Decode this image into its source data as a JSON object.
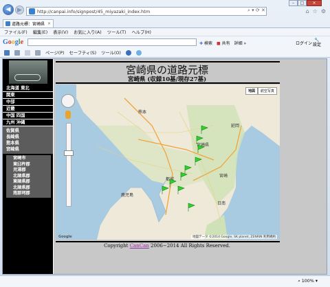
{
  "browser": {
    "url": "http://canpai.info/signpost/45_miyazaki_index.htm",
    "tab_title": "道路元標：宮崎県",
    "window_controls": [
      "–",
      "□",
      "×"
    ],
    "menu": [
      "ファイル(F)",
      "編集(E)",
      "表示(V)",
      "お気に入り(A)",
      "ツール(T)",
      "ヘルプ(H)"
    ],
    "google_bar": {
      "logo": "Google",
      "search_label": "検索",
      "share_label": "共有",
      "more_label": "詳細 »",
      "login_label": "ログイン",
      "settings_label": "設定"
    },
    "command_bar": [
      "ページ(P)",
      "セーフティ(S)",
      "ツール(O)"
    ],
    "zoom_level": "100%"
  },
  "nav": {
    "regions": [
      "北海道 東北",
      "関東",
      "中部",
      "近畿",
      "中国 四国",
      "九州 沖縄"
    ],
    "prefectures": [
      "佐賀県",
      "長崎県",
      "熊本県",
      "宮崎県"
    ],
    "municipalities": [
      "宮崎市",
      "東臼杵郡",
      "児湯郡",
      "北諸県郡",
      "東諸県郡",
      "北諸県郡",
      "南那珂郡"
    ]
  },
  "content": {
    "title": "宮崎県の道路元標",
    "subtitle": "宮崎県 (収録10基/現存27基)",
    "map": {
      "map_button": "地図",
      "satellite_button": "航空写真",
      "attribution": "地図データ ©2014 Google, SK planet, ZENRIN",
      "terms": "利用規約",
      "google_mark": "Google",
      "labels": [
        "熊本",
        "宮崎県",
        "鹿児島",
        "宮崎",
        "日南",
        "延岡",
        "都城"
      ],
      "marker_count": 10
    },
    "copyright_prefix": "Copyright",
    "copyright_link": "CanCan",
    "copyright_suffix": "2006−2014 All Rights Reserved."
  }
}
